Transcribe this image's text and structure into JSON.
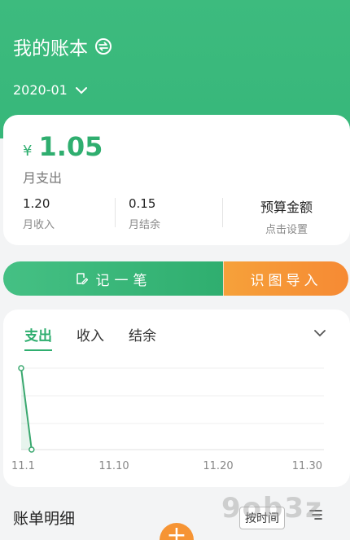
{
  "header": {
    "book_title": "我的账本",
    "month": "2020-01"
  },
  "summary": {
    "currency": "¥",
    "amount": "1.05",
    "amount_label": "月支出",
    "income_value": "1.20",
    "income_label": "月收入",
    "balance_value": "0.15",
    "balance_label": "月结余",
    "budget_title": "预算金额",
    "budget_hint": "点击设置"
  },
  "actions": {
    "record_label": "记一笔",
    "import_label": "识图导入"
  },
  "chart_tabs": [
    {
      "label": "支出",
      "active": true
    },
    {
      "label": "收入",
      "active": false
    },
    {
      "label": "结余",
      "active": false
    }
  ],
  "chart_data": {
    "type": "line",
    "x_tick_labels": [
      "11.1",
      "11.10",
      "11.20",
      "11.30"
    ],
    "series": [
      {
        "values": [
          {
            "day": 1,
            "level": 1.0
          },
          {
            "day": 2,
            "level": 0.0
          }
        ]
      }
    ],
    "x_range": [
      1,
      30
    ],
    "grid": true,
    "color": "#3aa86f"
  },
  "bill": {
    "title": "账单明细",
    "sort_label": "按时间"
  },
  "fab_label": "+",
  "watermark": "9ob3z",
  "colors": {
    "primary": "#37b77a",
    "accent": "#f68a34"
  }
}
